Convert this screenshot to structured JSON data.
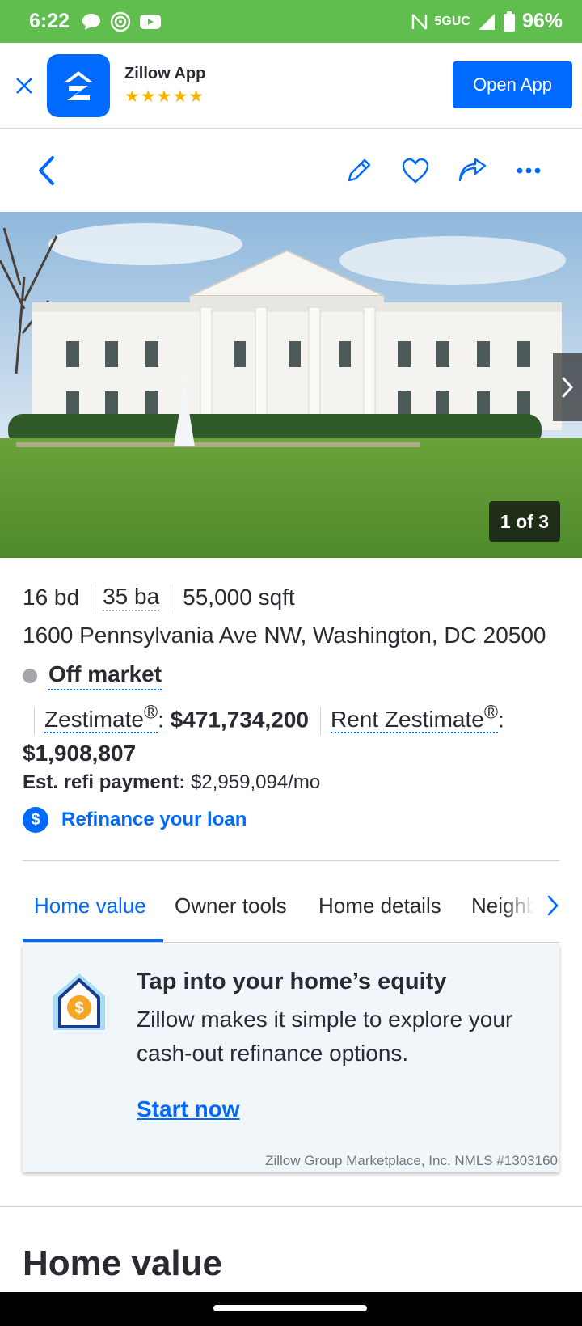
{
  "status_bar": {
    "time": "6:22",
    "network": "5GUC",
    "battery": "96%"
  },
  "app_banner": {
    "app_name": "Zillow App",
    "rating_stars": "★★★★★",
    "open_label": "Open App"
  },
  "photo": {
    "counter": "1 of 3"
  },
  "facts": {
    "beds": "16 bd",
    "baths": "35 ba",
    "sqft": "55,000 sqft"
  },
  "address": "1600 Pennsylvania Ave NW, Washington, DC 20500",
  "status": "Off market",
  "zestimate": {
    "label": "Zestimate",
    "reg": "®",
    "colon": ":",
    "value": "$471,734,200",
    "rent_label": "Rent Zestimate",
    "rent_value": "$1,908,807"
  },
  "refi": {
    "label": "Est. refi payment:",
    "value": "$2,959,094/mo",
    "link": "Refinance your loan",
    "link_icon": "$"
  },
  "tabs": [
    {
      "label": "Home value",
      "active": true
    },
    {
      "label": "Owner tools",
      "active": false
    },
    {
      "label": "Home details",
      "active": false
    },
    {
      "label": "Neighborhood",
      "active": false
    }
  ],
  "equity_card": {
    "title": "Tap into your home’s equity",
    "body": "Zillow makes it simple to explore your cash-out refinance options.",
    "cta": "Start now",
    "legal": "Zillow Group Marketplace, Inc. NMLS #1303160"
  },
  "section_title": "Home value",
  "colors": {
    "status_bar": "#5fbe4e",
    "brand_blue": "#006aff",
    "text": "#2a2a33"
  }
}
